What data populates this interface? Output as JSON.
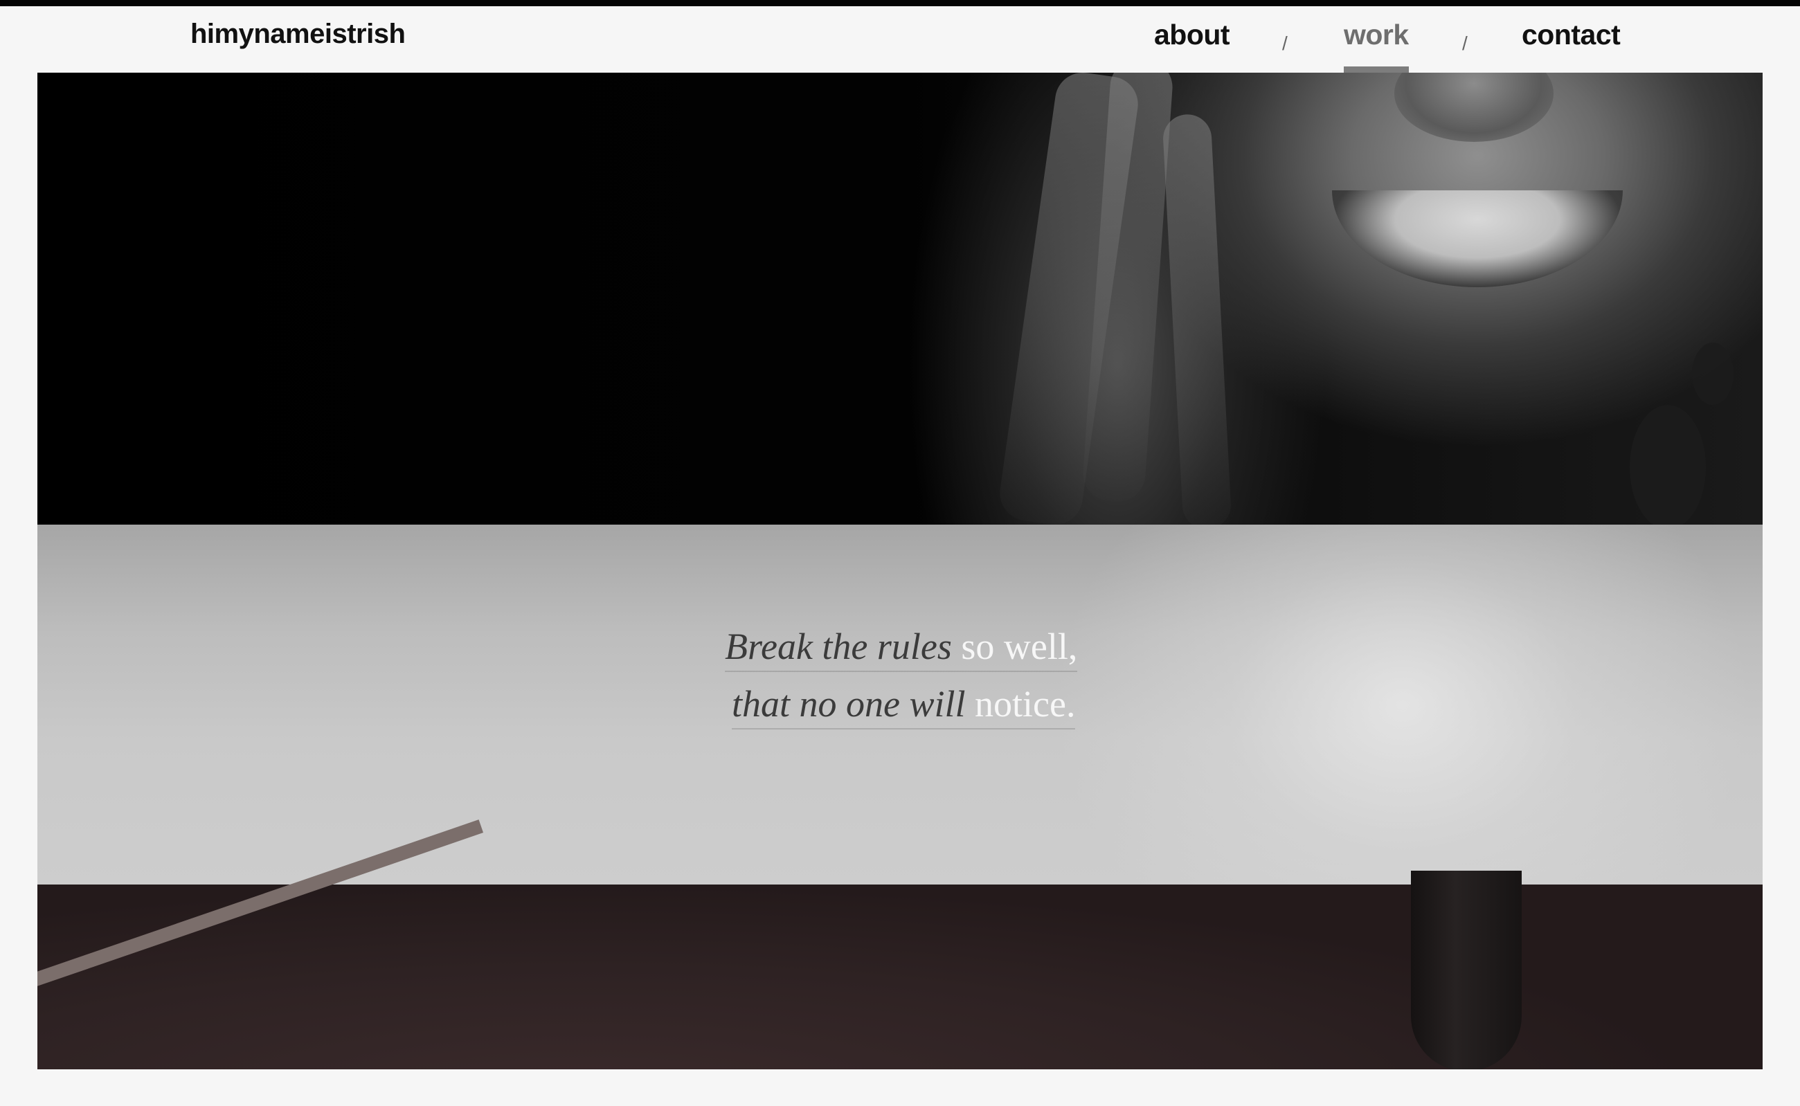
{
  "site": {
    "logo": "himynameistrish"
  },
  "nav": {
    "items": [
      {
        "label": "about",
        "active": false
      },
      {
        "label": "work",
        "active": true
      },
      {
        "label": "contact",
        "active": false
      }
    ],
    "separator": "/"
  },
  "hero": {
    "quote": {
      "line1_emphasis": "Break the rules",
      "line1_rest": "so well,",
      "line2_emphasis": "that no one will",
      "line2_rest": "notice."
    }
  },
  "colors": {
    "background": "#f6f6f6",
    "text_dark": "#111111",
    "nav_active": "#6e6e6e",
    "quote_dark": "#3b3b3b",
    "quote_light": "#f7f7f7"
  }
}
